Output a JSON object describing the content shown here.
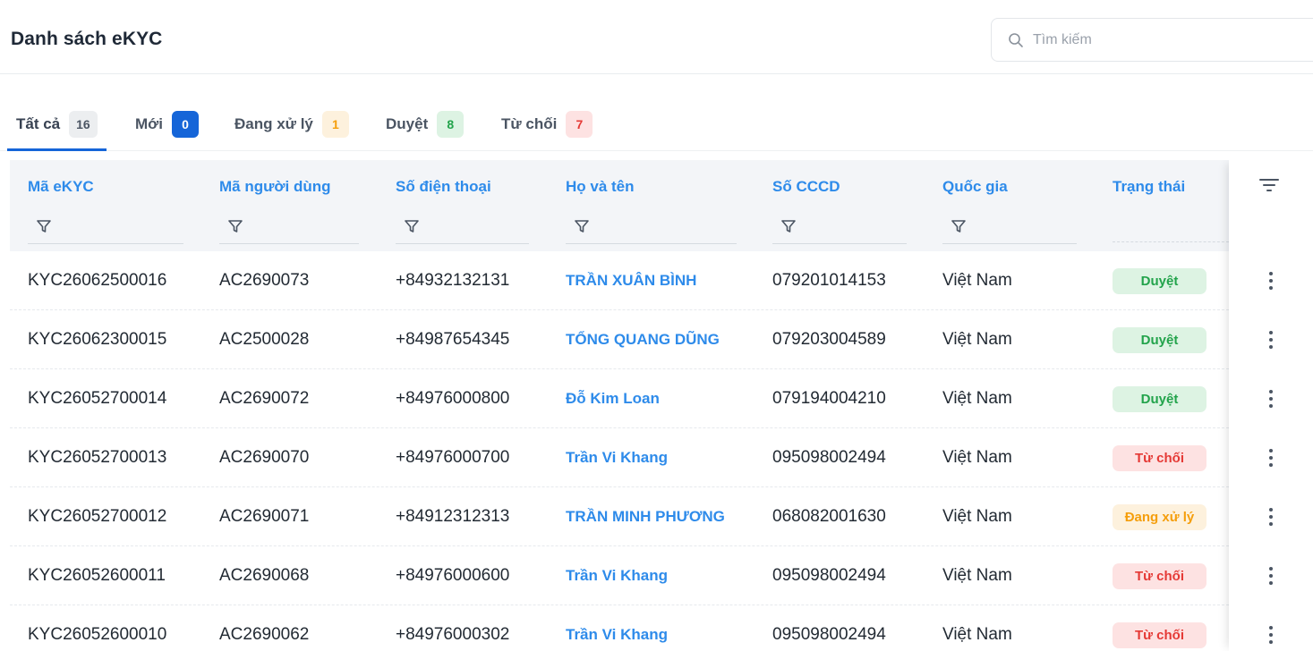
{
  "header": {
    "title": "Danh sách eKYC",
    "search_placeholder": "Tìm kiếm"
  },
  "tabs": [
    {
      "label": "Tất cả",
      "count": "16",
      "color": "gray",
      "active": true
    },
    {
      "label": "Mới",
      "count": "0",
      "color": "blue",
      "active": false
    },
    {
      "label": "Đang xử lý",
      "count": "1",
      "color": "orange",
      "active": false
    },
    {
      "label": "Duyệt",
      "count": "8",
      "color": "green",
      "active": false
    },
    {
      "label": "Từ chối",
      "count": "7",
      "color": "red",
      "active": false
    }
  ],
  "table": {
    "columns": [
      "Mã eKYC",
      "Mã người dùng",
      "Số điện thoại",
      "Họ và tên",
      "Số CCCD",
      "Quốc gia",
      "Trạng thái"
    ],
    "rows": [
      {
        "ekyc": "KYC26062500016",
        "user": "AC2690073",
        "phone": "+84932132131",
        "name": "TRẦN XUÂN BÌNH",
        "cccd": "079201014153",
        "country": "Việt Nam",
        "status": "Duyệt",
        "status_type": "approved"
      },
      {
        "ekyc": "KYC26062300015",
        "user": "AC2500028",
        "phone": "+84987654345",
        "name": "TỔNG QUANG DŨNG",
        "cccd": "079203004589",
        "country": "Việt Nam",
        "status": "Duyệt",
        "status_type": "approved"
      },
      {
        "ekyc": "KYC26052700014",
        "user": "AC2690072",
        "phone": "+84976000800",
        "name": "Đỗ Kim Loan",
        "cccd": "079194004210",
        "country": "Việt Nam",
        "status": "Duyệt",
        "status_type": "approved"
      },
      {
        "ekyc": "KYC26052700013",
        "user": "AC2690070",
        "phone": "+84976000700",
        "name": "Trần Vi Khang",
        "cccd": "095098002494",
        "country": "Việt Nam",
        "status": "Từ chối",
        "status_type": "rejected"
      },
      {
        "ekyc": "KYC26052700012",
        "user": "AC2690071",
        "phone": "+84912312313",
        "name": "TRẦN MINH PHƯƠNG",
        "cccd": "068082001630",
        "country": "Việt Nam",
        "status": "Đang xử lý",
        "status_type": "processing"
      },
      {
        "ekyc": "KYC26052600011",
        "user": "AC2690068",
        "phone": "+84976000600",
        "name": "Trần Vi Khang",
        "cccd": "095098002494",
        "country": "Việt Nam",
        "status": "Từ chối",
        "status_type": "rejected"
      },
      {
        "ekyc": "KYC26052600010",
        "user": "AC2690062",
        "phone": "+84976000302",
        "name": "Trần Vi Khang",
        "cccd": "095098002494",
        "country": "Việt Nam",
        "status": "Từ chối",
        "status_type": "rejected"
      }
    ]
  },
  "colors": {
    "accent": "#1565d8",
    "link": "#2e8bea",
    "approved": "#22a34b",
    "rejected": "#e53935",
    "processing": "#f59e0b"
  },
  "icons": {
    "search": "search-icon",
    "filter": "filter-icon",
    "column_settings": "column-settings-icon",
    "row_menu": "more-vertical-icon"
  }
}
